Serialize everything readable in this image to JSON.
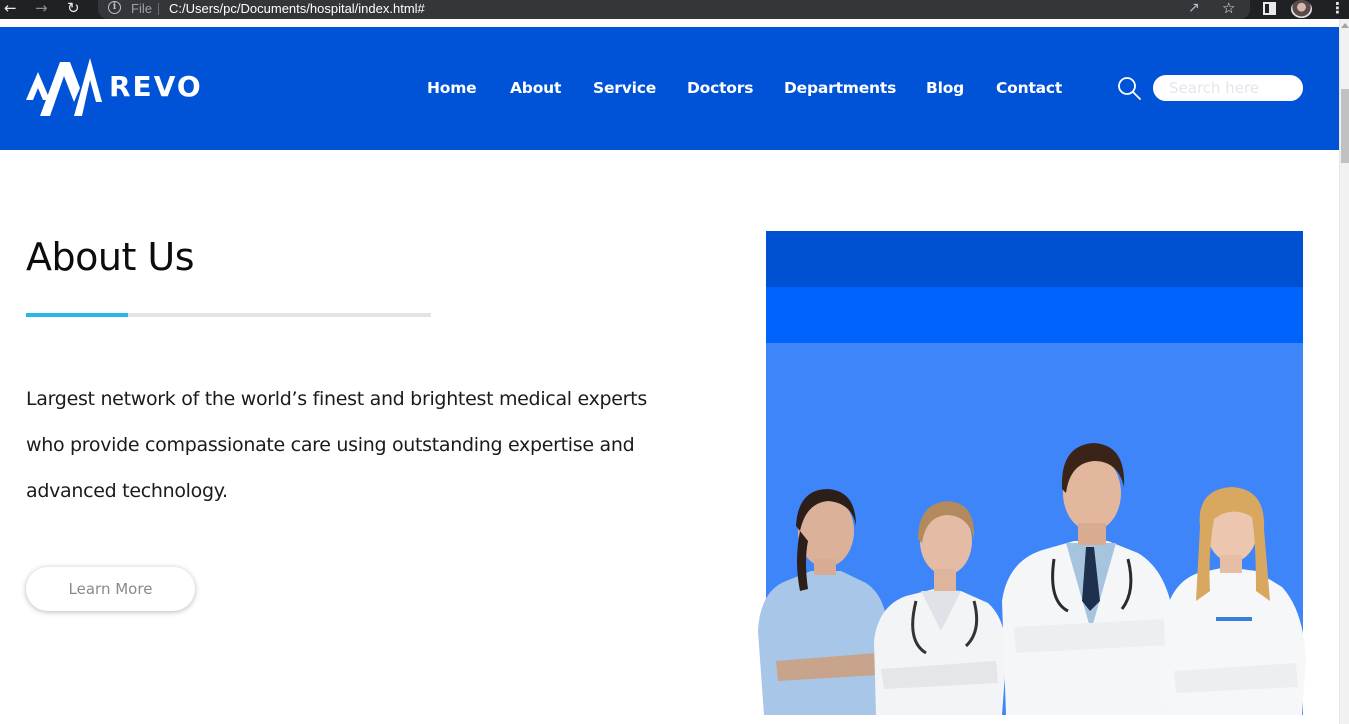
{
  "browser": {
    "file_label": "File",
    "url": "C:/Users/pc/Documents/hospital/index.html#",
    "back_icon": "arrow-left-icon",
    "forward_icon": "arrow-right-icon",
    "reload_icon": "reload-icon",
    "info_icon": "info-icon",
    "share_icon": "share-icon",
    "bookmark_icon": "star-icon",
    "menu_icon": "kebab-menu-icon"
  },
  "header": {
    "logo_text": "REVO",
    "nav": [
      "Home",
      "About",
      "Service",
      "Doctors",
      "Departments",
      "Blog",
      "Contact"
    ],
    "search_placeholder": "Search here",
    "background": "#0052d6"
  },
  "about": {
    "title": "About Us",
    "body": "Largest network of the world’s finest and brightest medical experts who provide compassionate care using outstanding expertise and advanced technology.",
    "button_label": "Learn More",
    "accent": "#29b6e8"
  },
  "photo_panel": {
    "band_colors": [
      "#0050d3",
      "#0063fb",
      "#3f85fa"
    ],
    "image": "four-doctors-in-white-coats"
  }
}
